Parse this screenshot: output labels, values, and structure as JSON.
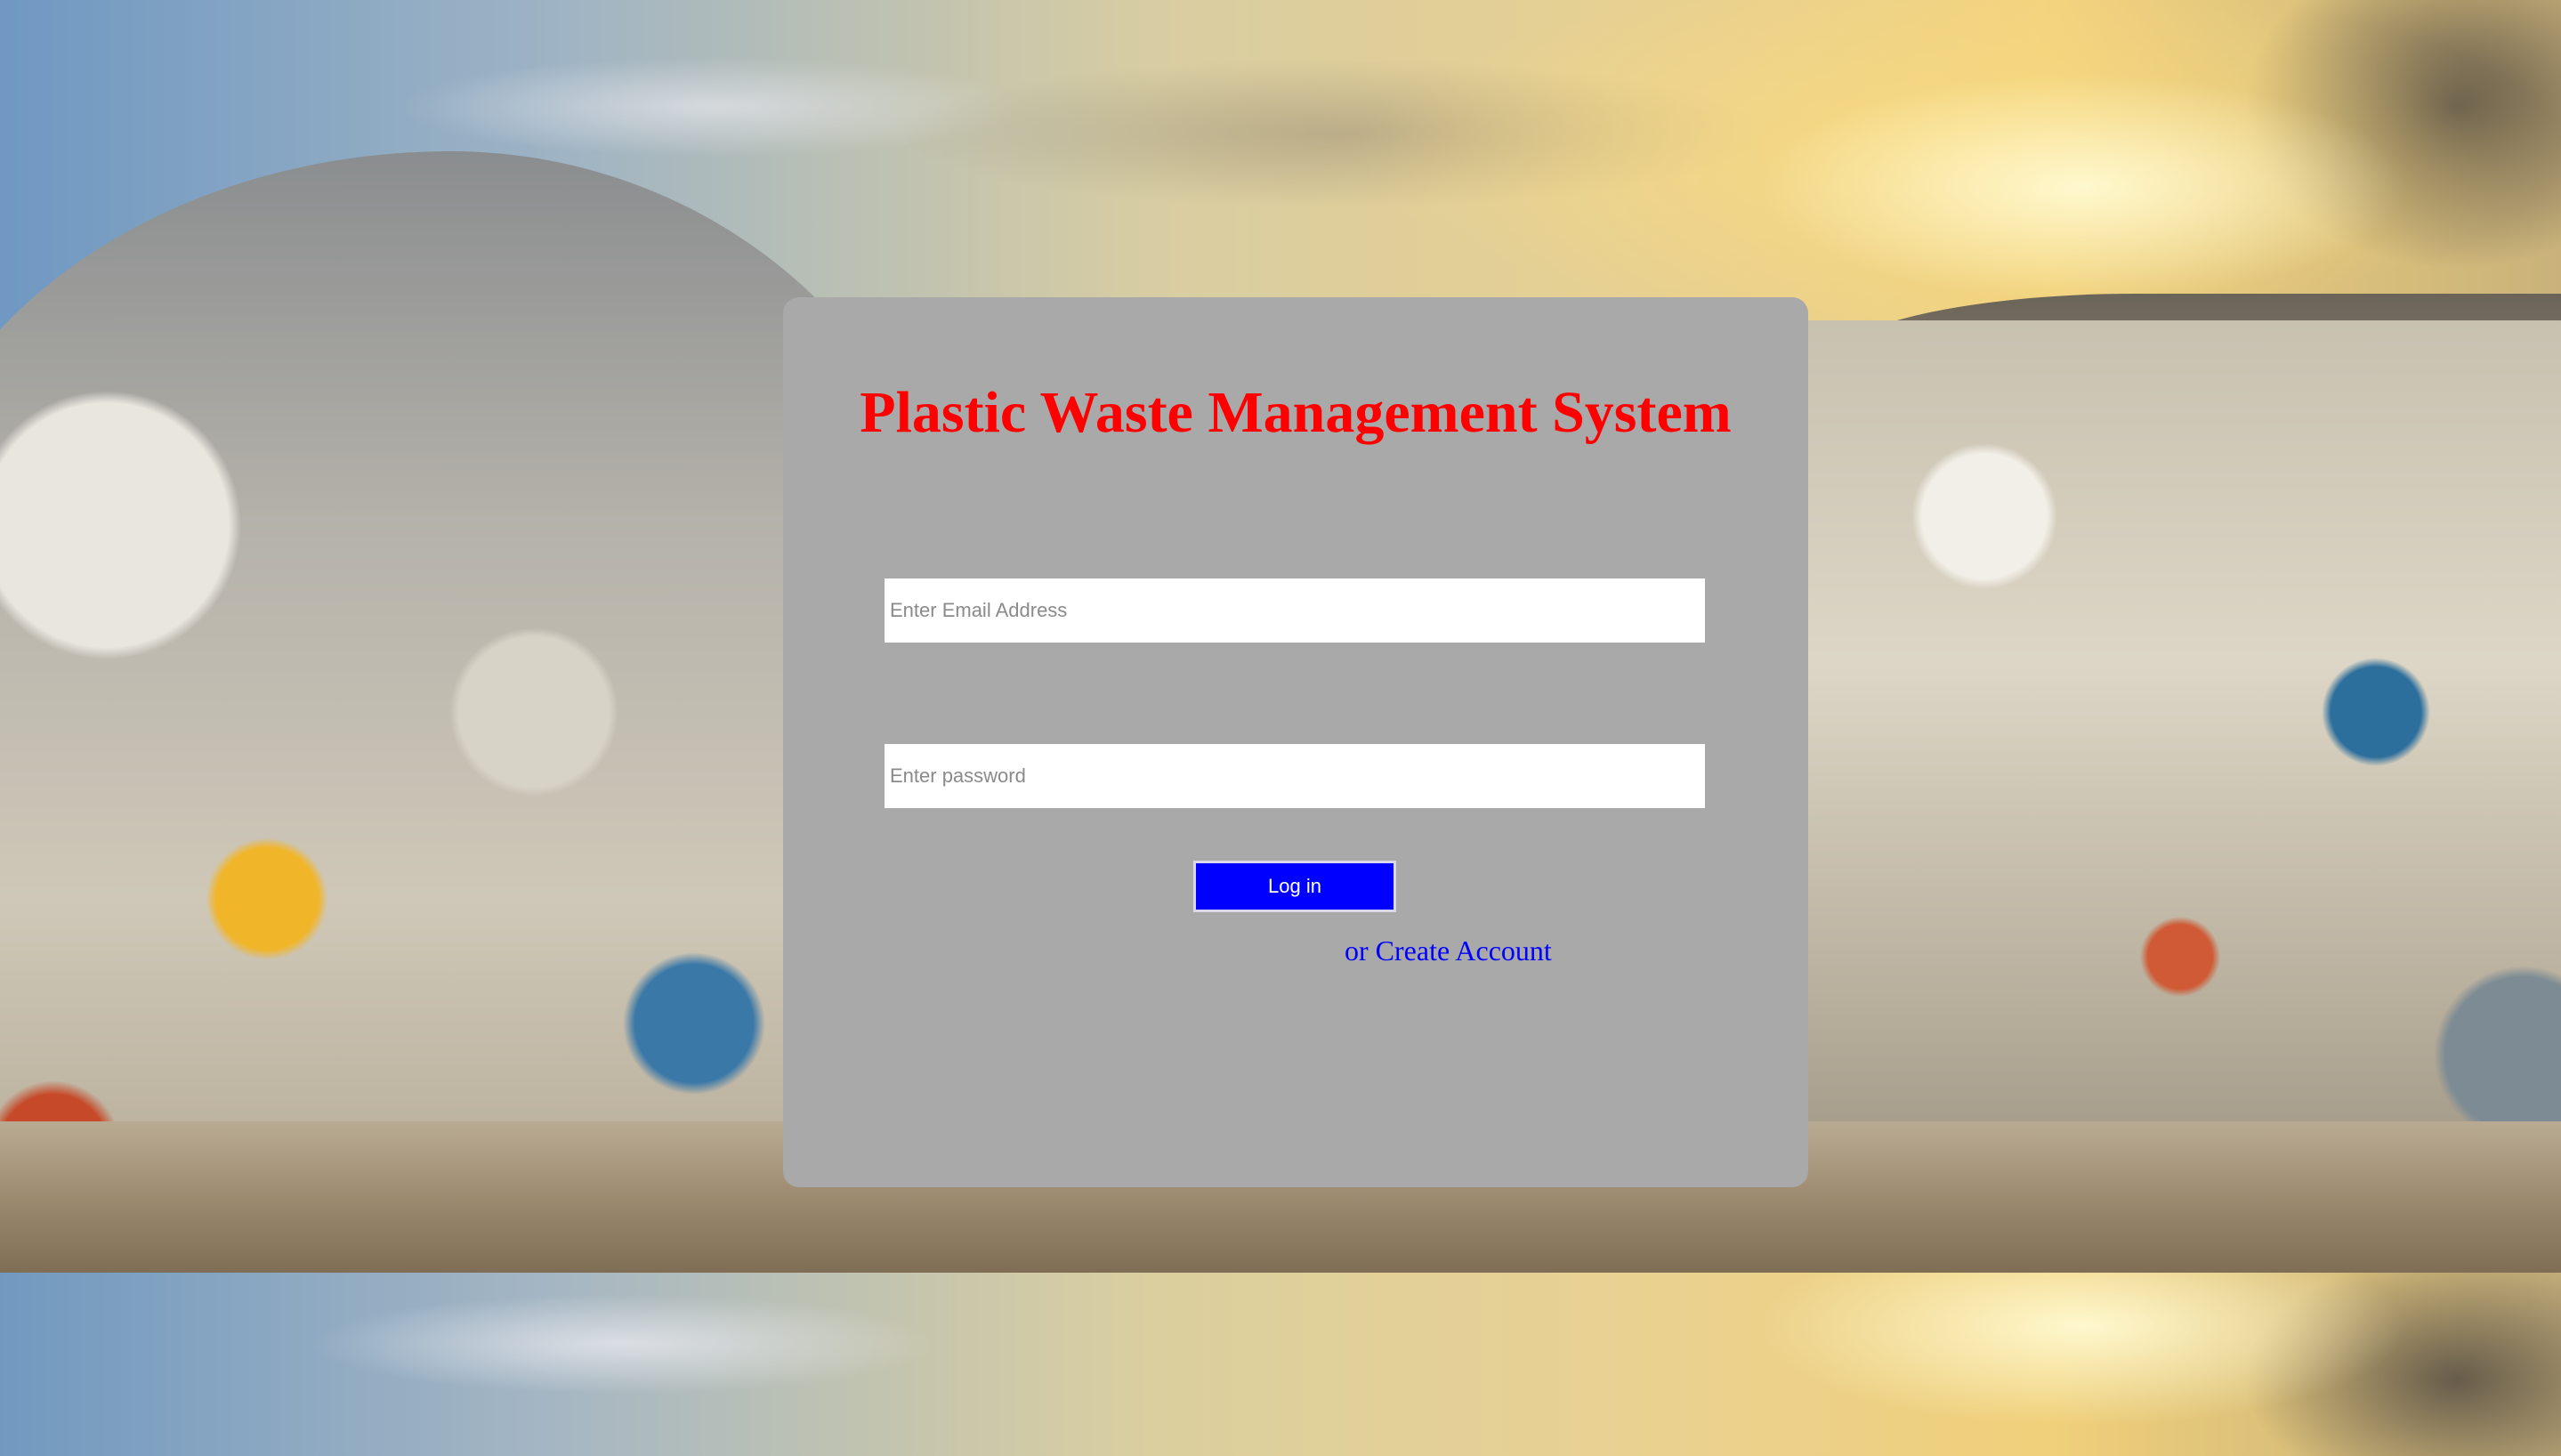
{
  "app": {
    "title": "Plastic Waste Management System"
  },
  "login_form": {
    "email": {
      "value": "",
      "placeholder": "Enter Email Address"
    },
    "password": {
      "value": "",
      "placeholder": "Enter password"
    },
    "login_button_label": "Log in",
    "create_account_link": "or Create Account"
  },
  "colors": {
    "title": "#ff0000",
    "card_background": "#a9a9a9",
    "button_background": "#0000ff",
    "link": "#0000ff"
  }
}
